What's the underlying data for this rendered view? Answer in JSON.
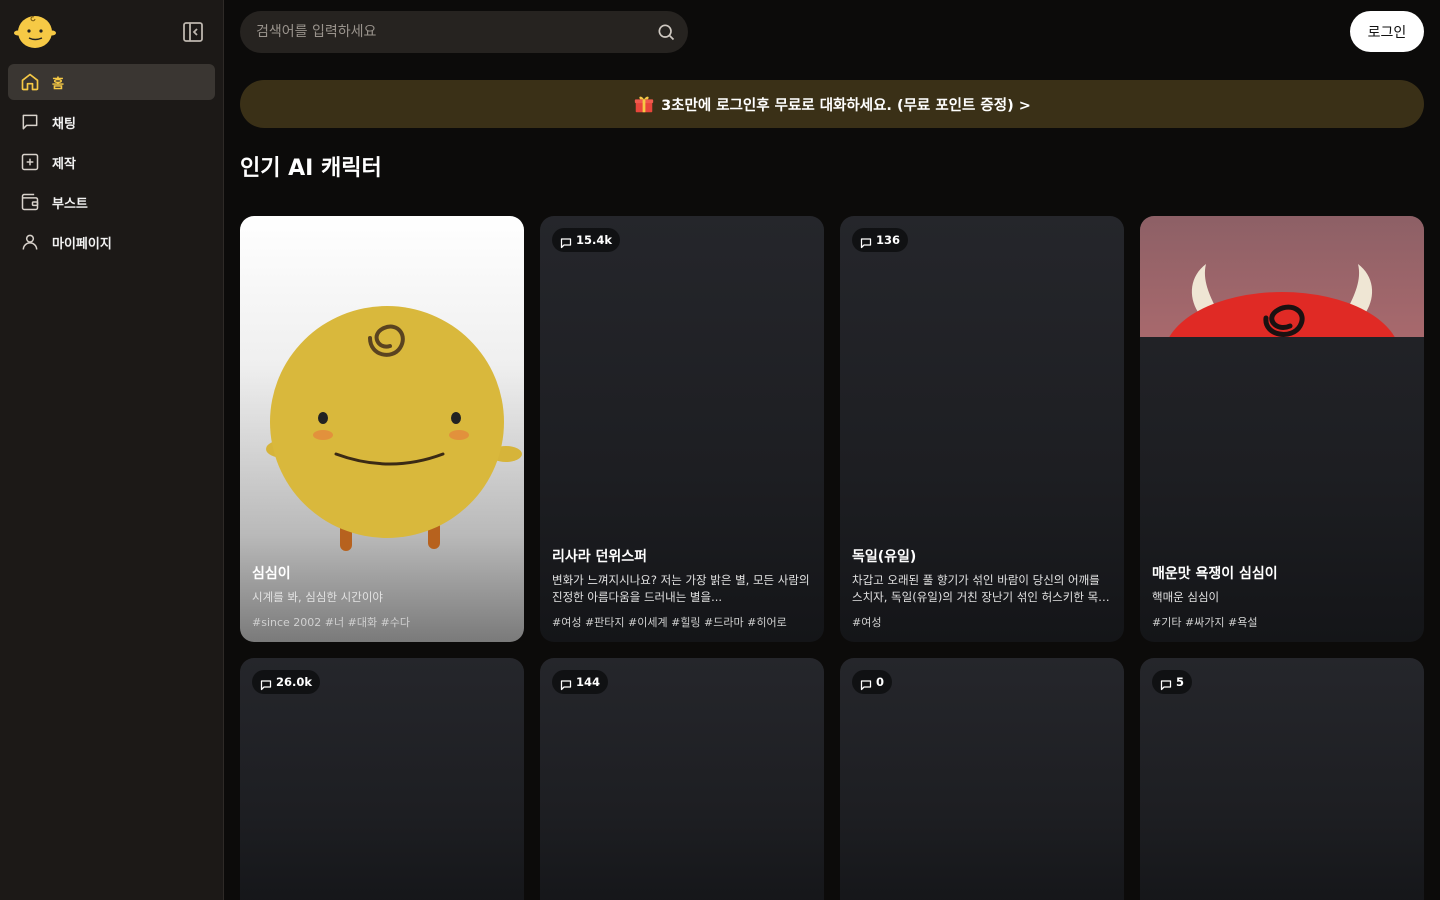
{
  "search": {
    "placeholder": "검색어를 입력하세요"
  },
  "header": {
    "login_label": "로그인"
  },
  "sidebar": {
    "items": [
      {
        "label": "홈",
        "icon": "home-icon",
        "active": true
      },
      {
        "label": "채팅",
        "icon": "chat-icon"
      },
      {
        "label": "제작",
        "icon": "plus-square-icon"
      },
      {
        "label": "부스트",
        "icon": "wallet-icon"
      },
      {
        "label": "마이페이지",
        "icon": "user-icon"
      }
    ]
  },
  "promo": {
    "text": "3초만에 로그인후 무료로 대화하세요. (무료 포인트 증정) >",
    "icon": "gift-icon"
  },
  "section": {
    "title": "인기 AI 캐릭터"
  },
  "cards": [
    {
      "name": "심심이",
      "desc": "시계를 봐, 심심한 시간이야",
      "tags": "#since 2002 #너 #대화 #수다"
    },
    {
      "count": "15.4k",
      "name": "리사라 던위스퍼",
      "desc": "변화가 느껴지시나요? 저는 가장 밝은 별, 모든 사람의 진정한 아름다움을 드러내는 별을...",
      "tags": "#여성 #판타지 #이세계 #힐링 #드라마 #히어로"
    },
    {
      "count": "136",
      "name": "독일(유일)",
      "desc": "차갑고 오래된 풀 향기가 섞인 바람이 당신의 어깨를 스치자, 독일(유일)의 거친 장난기 섞인 허스키한 목소리...",
      "tags": "#여성"
    },
    {
      "name": "매운맛 욕쟁이 심심이",
      "desc": "핵매운 심심이",
      "tags": "#기타 #싸가지 #욕설"
    },
    {
      "count": "26.0k"
    },
    {
      "count": "144"
    },
    {
      "count": "0"
    },
    {
      "count": "5"
    }
  ],
  "colors": {
    "accent": "#f6c945",
    "sidebar_bg": "#1c1917",
    "promo_bg": "#3a3017",
    "page_bg": "#0c0b0a"
  }
}
